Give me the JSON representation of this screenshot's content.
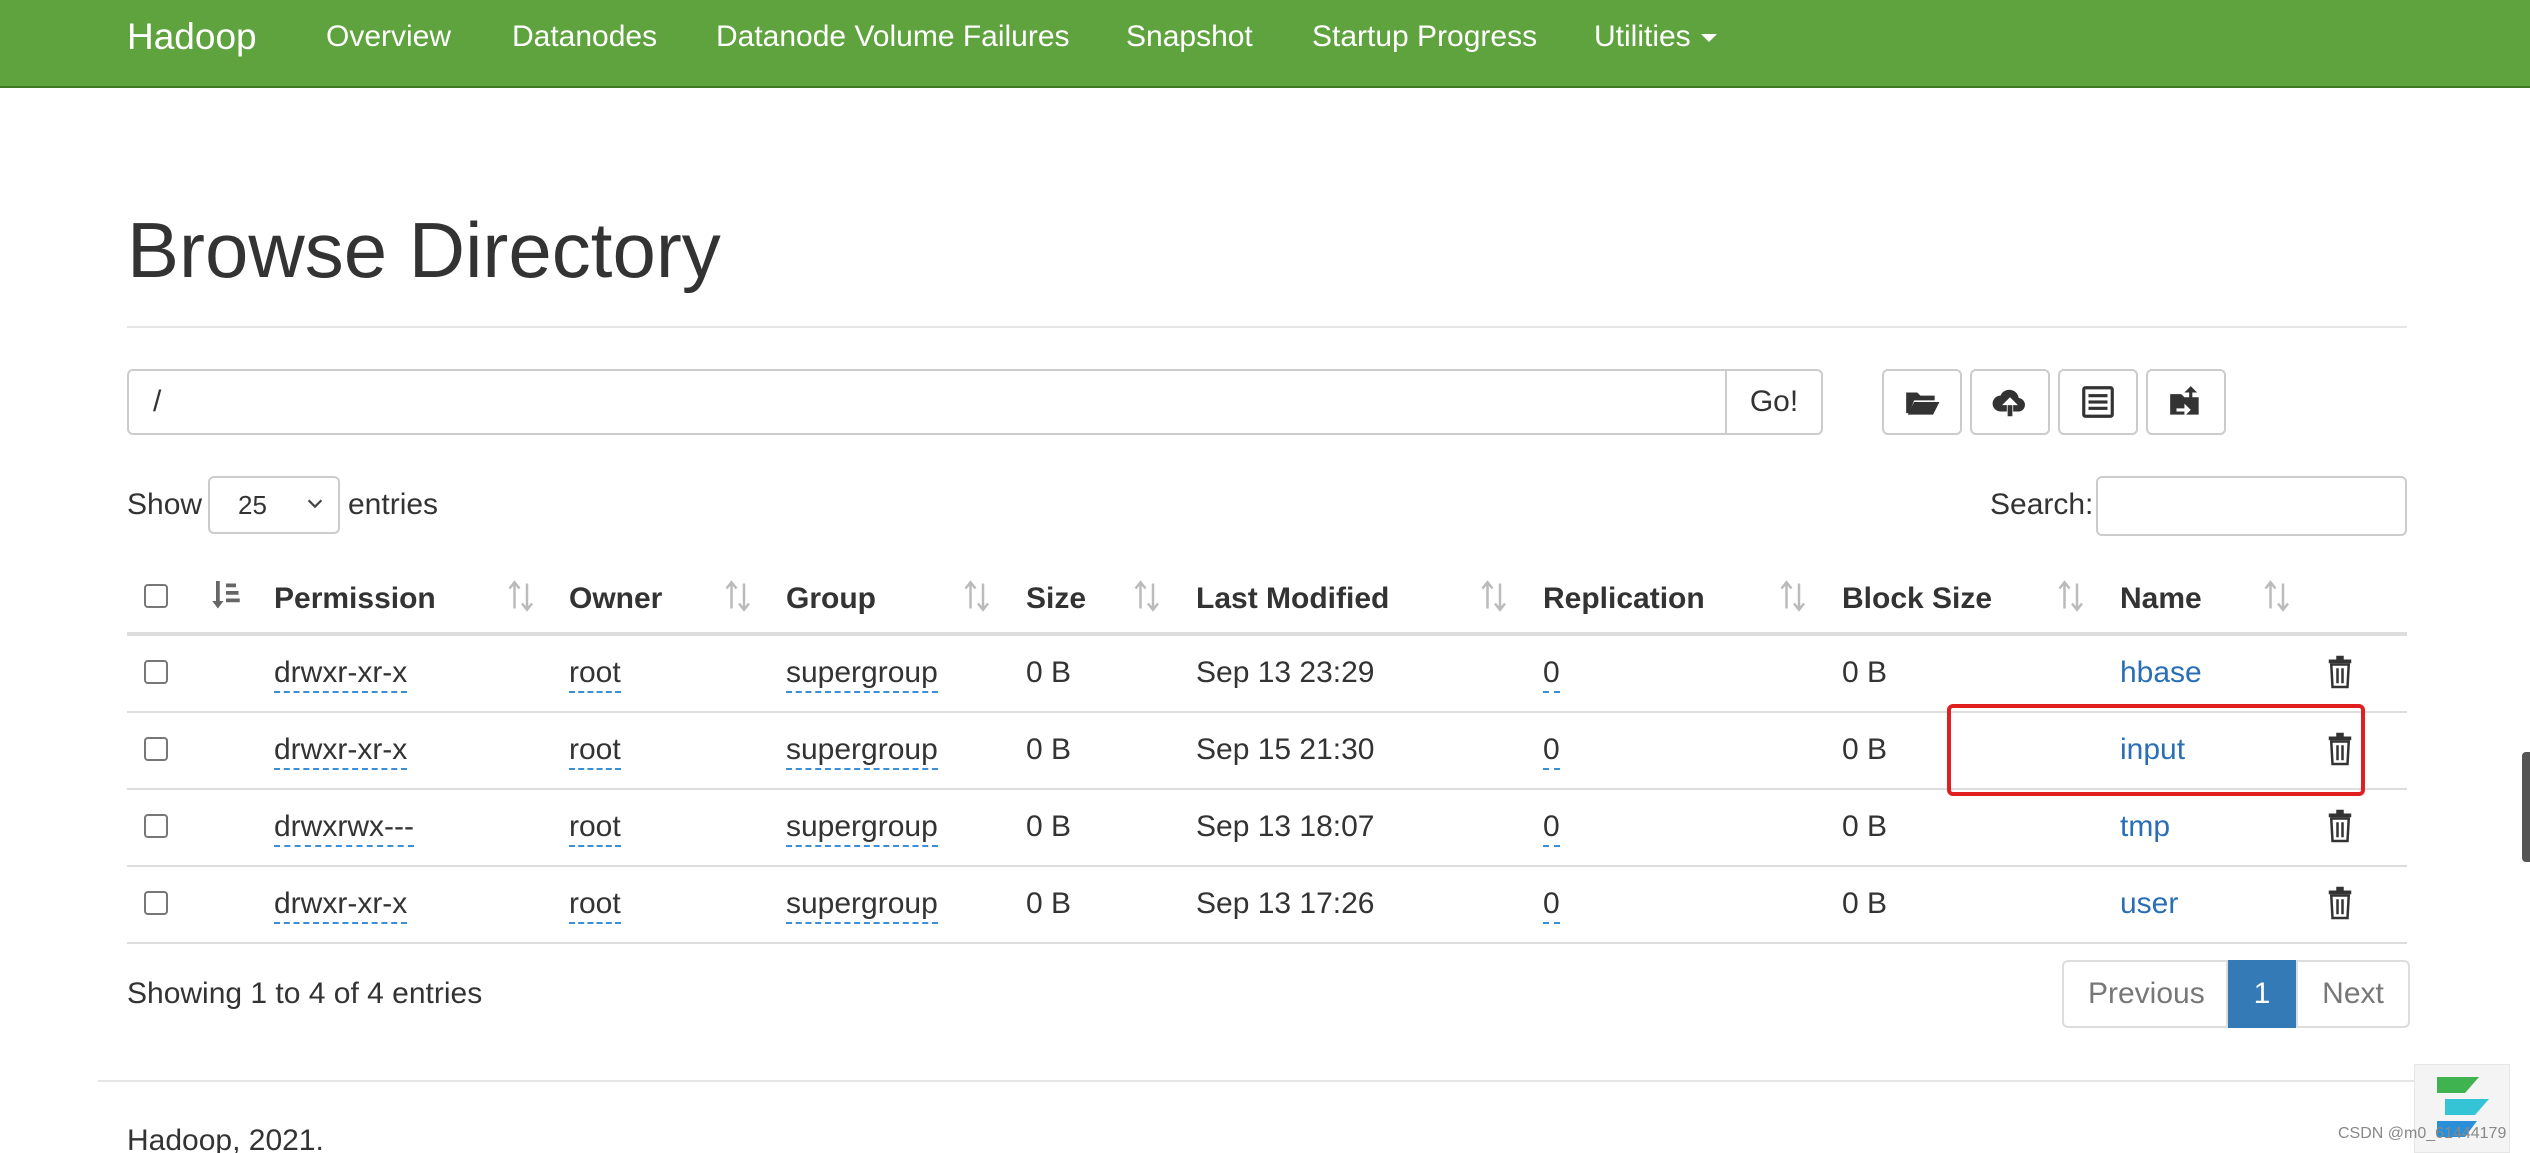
{
  "navbar": {
    "brand": "Hadoop",
    "items": [
      "Overview",
      "Datanodes",
      "Datanode Volume Failures",
      "Snapshot",
      "Startup Progress",
      "Utilities"
    ]
  },
  "page": {
    "title": "Browse Directory"
  },
  "path_bar": {
    "value": "/",
    "go_label": "Go!"
  },
  "toolbar": {
    "icons": [
      "folder-open-icon",
      "cloud-upload-icon",
      "list-icon",
      "folder-upload-icon"
    ]
  },
  "entries": {
    "show_label": "Show",
    "selected": "25",
    "suffix_label": "entries"
  },
  "search": {
    "label": "Search:",
    "value": ""
  },
  "table": {
    "headers": [
      "Permission",
      "Owner",
      "Group",
      "Size",
      "Last Modified",
      "Replication",
      "Block Size",
      "Name"
    ],
    "rows": [
      {
        "permission": "drwxr-xr-x",
        "owner": "root",
        "group": "supergroup",
        "size": "0 B",
        "modified": "Sep 13 23:29",
        "replication": "0",
        "block_size": "0 B",
        "name": "hbase"
      },
      {
        "permission": "drwxr-xr-x",
        "owner": "root",
        "group": "supergroup",
        "size": "0 B",
        "modified": "Sep 15 21:30",
        "replication": "0",
        "block_size": "0 B",
        "name": "input"
      },
      {
        "permission": "drwxrwx---",
        "owner": "root",
        "group": "supergroup",
        "size": "0 B",
        "modified": "Sep 13 18:07",
        "replication": "0",
        "block_size": "0 B",
        "name": "tmp"
      },
      {
        "permission": "drwxr-xr-x",
        "owner": "root",
        "group": "supergroup",
        "size": "0 B",
        "modified": "Sep 13 17:26",
        "replication": "0",
        "block_size": "0 B",
        "name": "user"
      }
    ]
  },
  "info": "Showing 1 to 4 of 4 entries",
  "pagination": {
    "previous": "Previous",
    "current": "1",
    "next": "Next"
  },
  "footer": "Hadoop, 2021.",
  "watermark": "CSDN @m0_61444179",
  "colors": {
    "navbar": "#5fa33e",
    "link": "#2a6eb5",
    "active_page": "#337ab7",
    "highlight": "#e02020"
  }
}
